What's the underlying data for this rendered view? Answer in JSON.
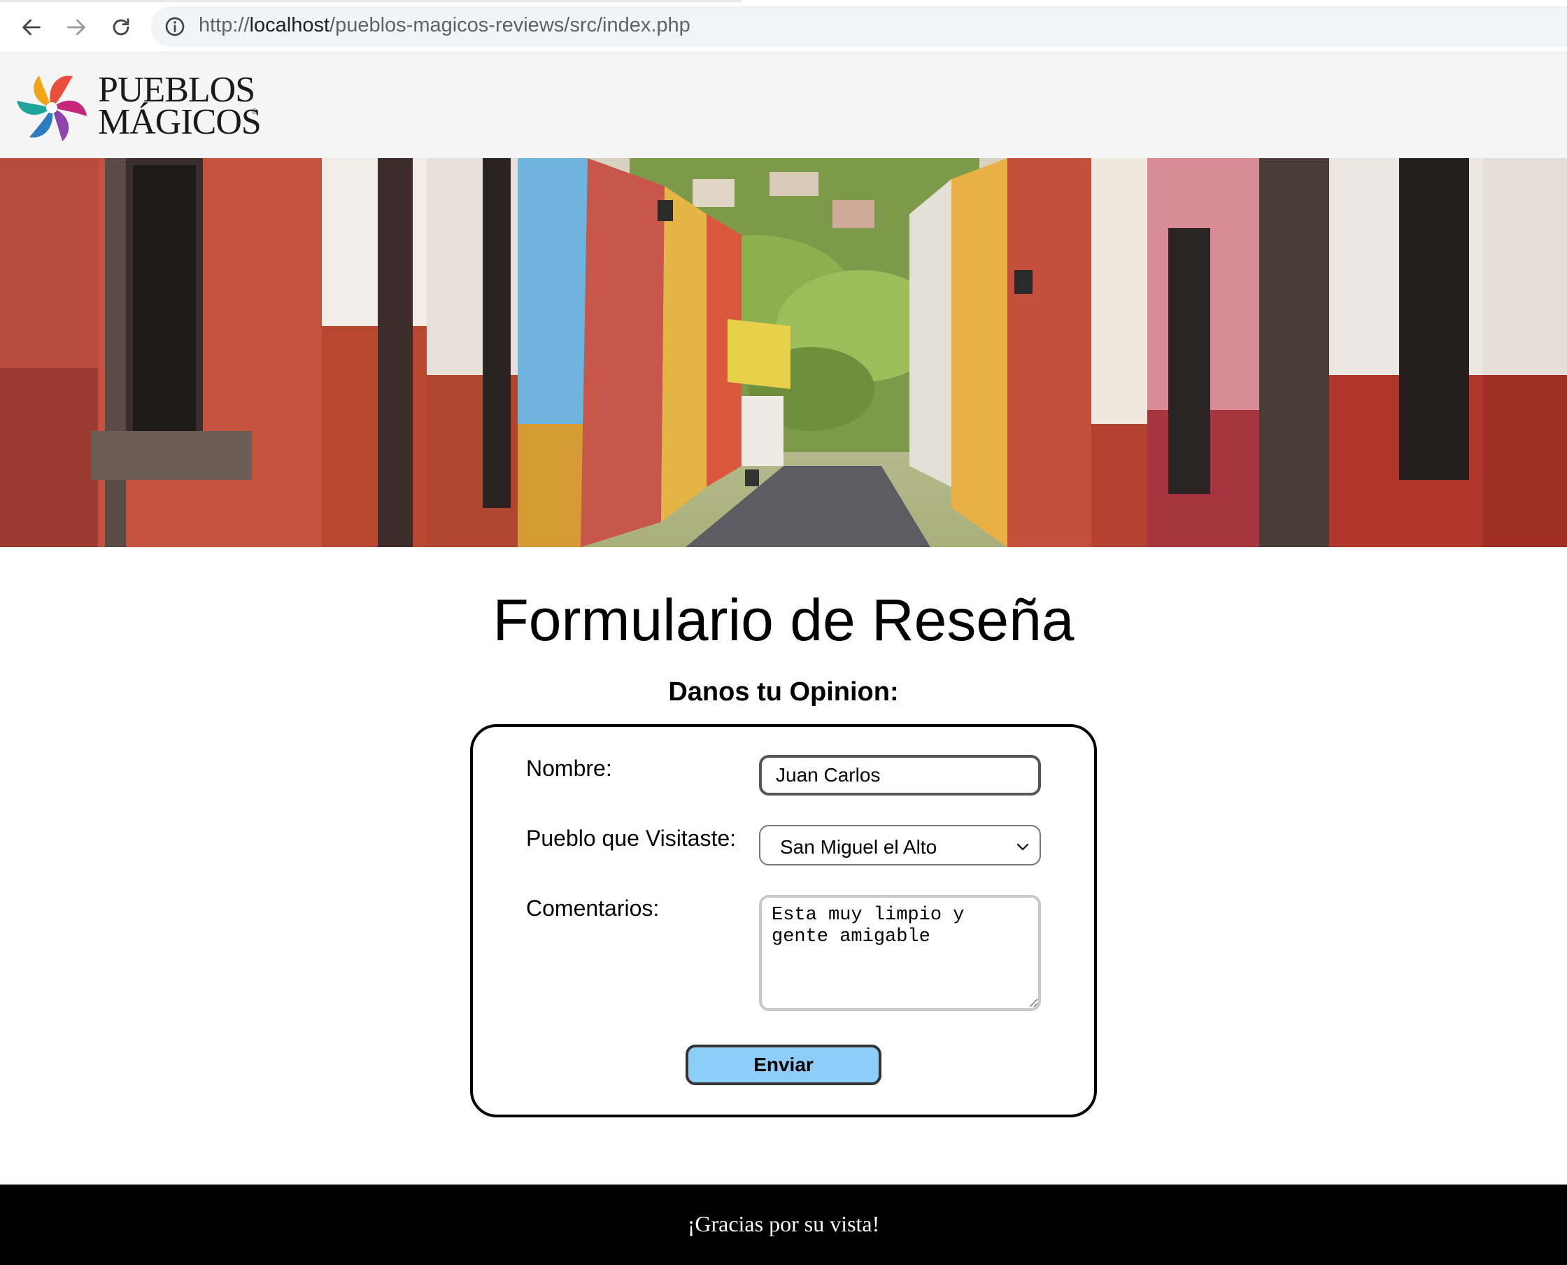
{
  "browser": {
    "url_prefix": "http://",
    "url_host": "localhost",
    "url_path": "/pueblos-magicos-reviews/src/index.php",
    "back_icon": "arrow-left-icon",
    "forward_icon": "arrow-right-icon",
    "reload_icon": "reload-icon",
    "info_icon": "info-circle-icon"
  },
  "header": {
    "logo_line1": "PUEBLOS",
    "logo_line2": "MÁGICOS",
    "logo_reg": "®"
  },
  "main": {
    "title": "Formulario de Reseña",
    "subtitle": "Danos tu Opinion:"
  },
  "form": {
    "nombre_label": "Nombre:",
    "nombre_value": "Juan Carlos",
    "pueblo_label": "Pueblo que Visitaste:",
    "pueblo_value": "San Miguel el Alto",
    "comentarios_label": "Comentarios:",
    "comentarios_value": "Esta muy limpio y gente amigable",
    "submit_label": "Enviar"
  },
  "footer": {
    "text": "¡Gracias por su vista!"
  },
  "colors": {
    "button_bg": "#8ecdf7",
    "footer_bg": "#000000",
    "header_bg": "#f5f5f5"
  }
}
